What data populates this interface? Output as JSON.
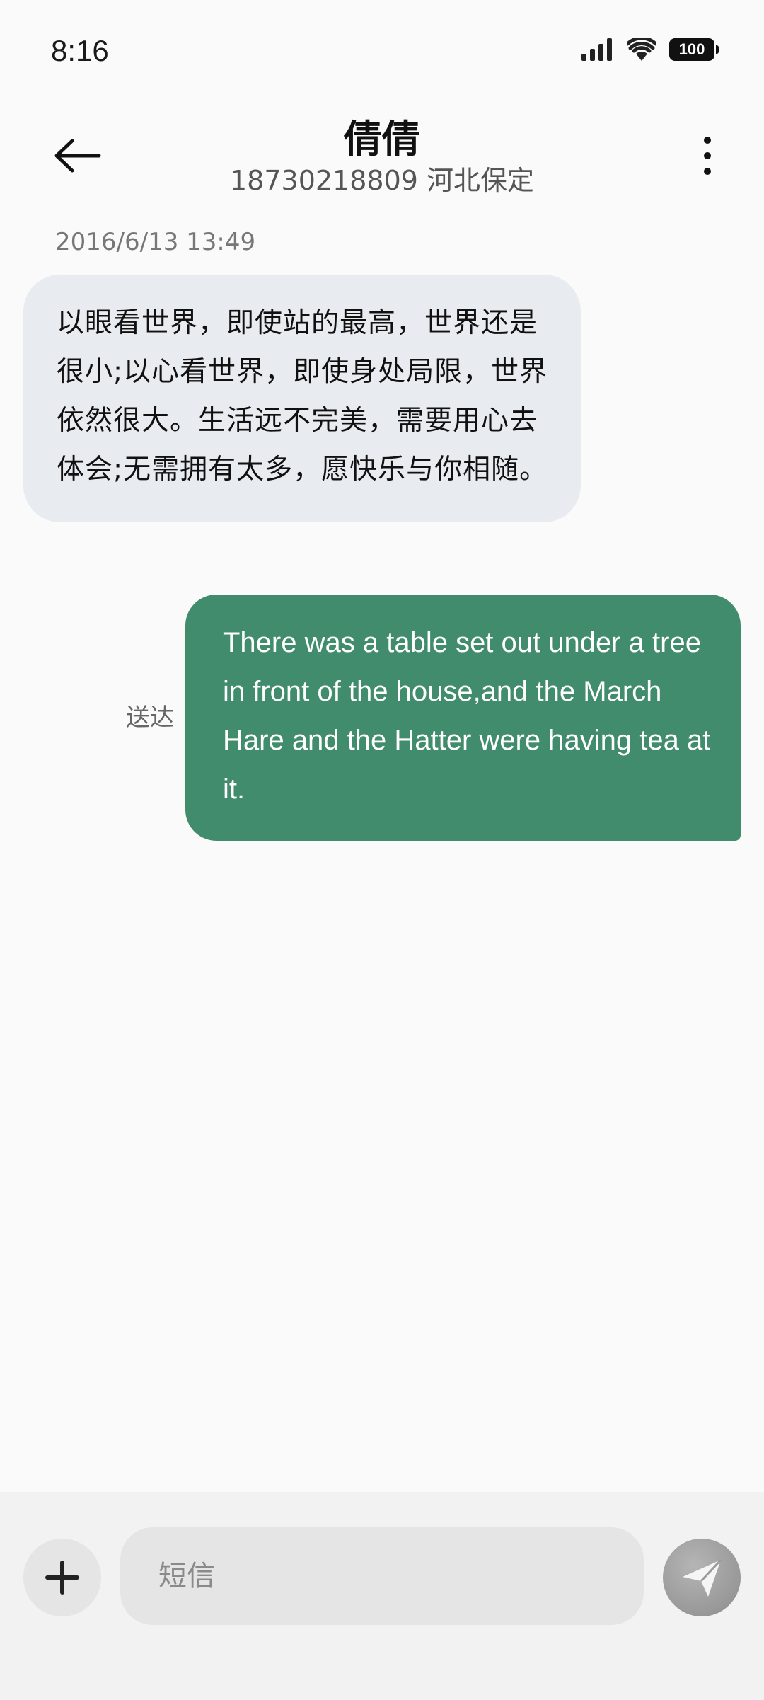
{
  "status_bar": {
    "time": "8:16",
    "battery": "100",
    "icons": [
      "signal-icon",
      "wifi-icon",
      "battery-icon"
    ]
  },
  "header": {
    "contact_name": "倩倩",
    "contact_subtitle": "18730218809 河北保定",
    "icons": [
      "back-arrow-icon",
      "more-vertical-icon"
    ]
  },
  "conversation": {
    "timestamp": "2016/6/13 13:49",
    "messages": [
      {
        "direction": "incoming",
        "text": "以眼看世界，即使站的最高，世界还是很小;以心看世界，即使身处局限，世界依然很大。生活远不完美，需要用心去体会;无需拥有太多，愿快乐与你相随。"
      },
      {
        "direction": "outgoing",
        "text": "There was a table set out under a tree in front of the house,and the March Hare and the Hatter were having tea at it.",
        "status": "送达"
      }
    ]
  },
  "composer": {
    "placeholder": "短信",
    "value": "",
    "icons": [
      "plus-icon",
      "send-icon"
    ]
  },
  "colors": {
    "incoming_bubble": "#e8ebef",
    "outgoing_bubble": "#418c6d",
    "background": "#fafafa",
    "input_bar": "#f2f2f2"
  }
}
